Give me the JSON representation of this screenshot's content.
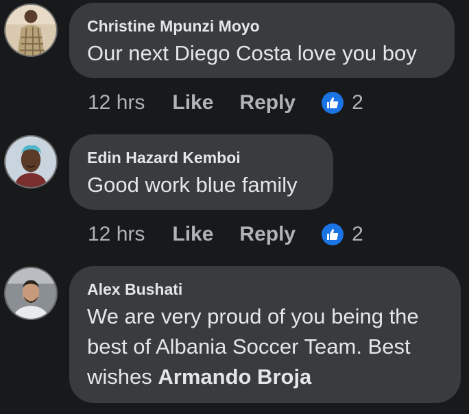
{
  "comments": [
    {
      "author": "Christine Mpunzi Moyo",
      "text": "Our next Diego Costa love you boy",
      "time": "12 hrs",
      "like_label": "Like",
      "reply_label": "Reply",
      "reaction_icon": "like-icon",
      "reaction_count": "2"
    },
    {
      "author": "Edin Hazard Kemboi",
      "text": "Good work blue family",
      "time": "12 hrs",
      "like_label": "Like",
      "reply_label": "Reply",
      "reaction_icon": "like-icon",
      "reaction_count": "2"
    },
    {
      "author": "Alex Bushati",
      "text_line1": "We are very proud of you being the",
      "text_line2": "best of Albania Soccer Team. Best",
      "text_line3_plain": "wishes ",
      "text_line3_bold": "Armando Broja"
    }
  ],
  "colors": {
    "background": "#18191a",
    "bubble": "#3a3b3c",
    "primary_text": "#e4e6eb",
    "secondary_text": "#b0b3b8",
    "like_blue": "#1b74e4"
  }
}
